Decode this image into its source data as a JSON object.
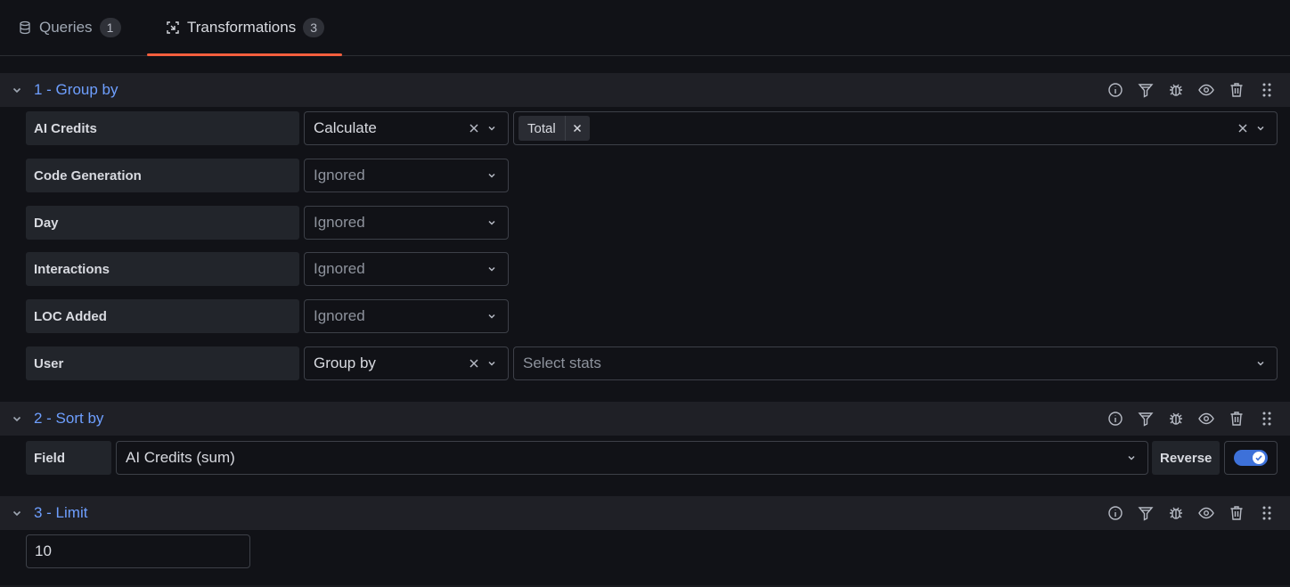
{
  "tabs": [
    {
      "label": "Queries",
      "count": "1"
    },
    {
      "label": "Transformations",
      "count": "3"
    }
  ],
  "transformations": [
    {
      "title": "1 - Group by",
      "rows": [
        {
          "field": "AI Credits",
          "mode": "Calculate",
          "stats_chip": "Total"
        },
        {
          "field": "Code Generation",
          "mode": "Ignored"
        },
        {
          "field": "Day",
          "mode": "Ignored"
        },
        {
          "field": "Interactions",
          "mode": "Ignored"
        },
        {
          "field": "LOC Added",
          "mode": "Ignored"
        },
        {
          "field": "User",
          "mode": "Group by",
          "stats_placeholder": "Select stats"
        }
      ]
    },
    {
      "title": "2 - Sort by",
      "field_label": "Field",
      "field_value": "AI Credits (sum)",
      "reverse_label": "Reverse",
      "reverse_on": true
    },
    {
      "title": "3 - Limit",
      "limit_value": "10"
    }
  ],
  "colors": {
    "accent": "#f55f3e",
    "title": "#6e9fff",
    "toggle": "#3d71d9"
  }
}
